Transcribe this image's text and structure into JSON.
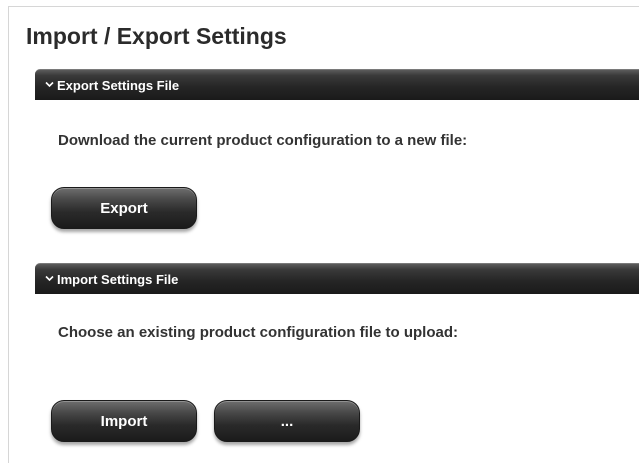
{
  "page": {
    "title": "Import / Export Settings"
  },
  "export_section": {
    "header": "Export Settings File",
    "description": "Download the current product configuration to a new file:",
    "export_button": "Export"
  },
  "import_section": {
    "header": "Import Settings File",
    "description": "Choose an existing product configuration file to upload:",
    "import_button": "Import",
    "browse_button": "..."
  },
  "icons": {
    "section_toggle": "chevron-down-icon"
  },
  "colors": {
    "section_header_bg": "#262626",
    "button_bg": "#2a2a2a",
    "button_text": "#ffffff",
    "title_text": "#2b2b2b",
    "body_text": "#333333"
  }
}
